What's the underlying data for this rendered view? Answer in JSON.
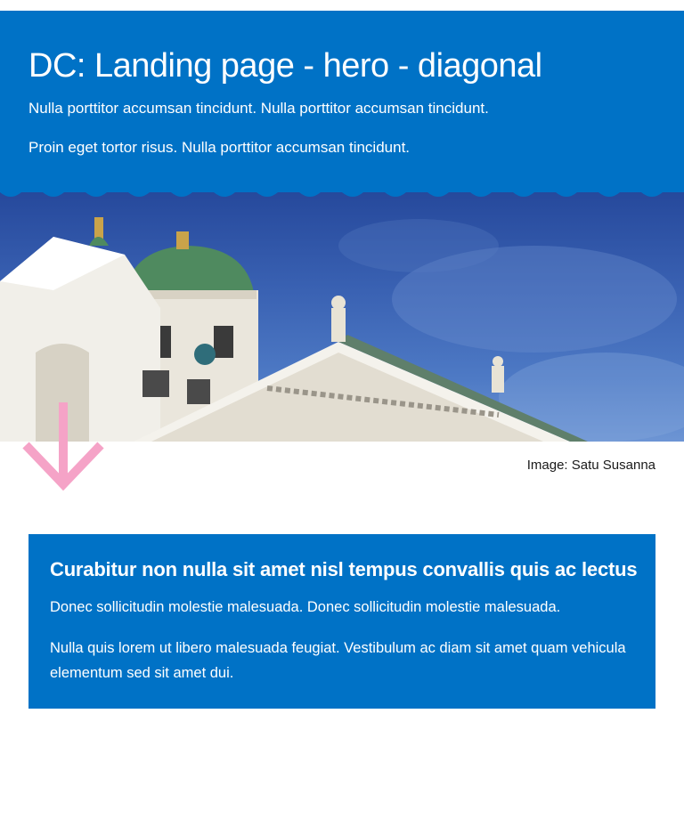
{
  "hero": {
    "title": "DC: Landing page - hero - diagonal",
    "paragraph_1": "Nulla porttitor accumsan tincidunt. Nulla porttitor accumsan tincidunt.",
    "paragraph_2": "Proin eget tortor risus. Nulla porttitor accumsan tincidunt.",
    "background_color": "#0072c6"
  },
  "image": {
    "caption": "Image: Satu Susanna"
  },
  "scroll_indicator": {
    "icon": "arrow-down-icon",
    "color": "#f5a3c7"
  },
  "card": {
    "title": "Curabitur non nulla sit amet nisl tempus convallis quis ac lectus",
    "paragraph_1": "Donec sollicitudin molestie malesuada. Donec sollicitudin molestie malesuada.",
    "paragraph_2": "Nulla quis lorem ut libero malesuada feugiat. Vestibulum ac diam sit amet quam vehicula elementum sed sit amet dui.",
    "background_color": "#0072c6"
  }
}
